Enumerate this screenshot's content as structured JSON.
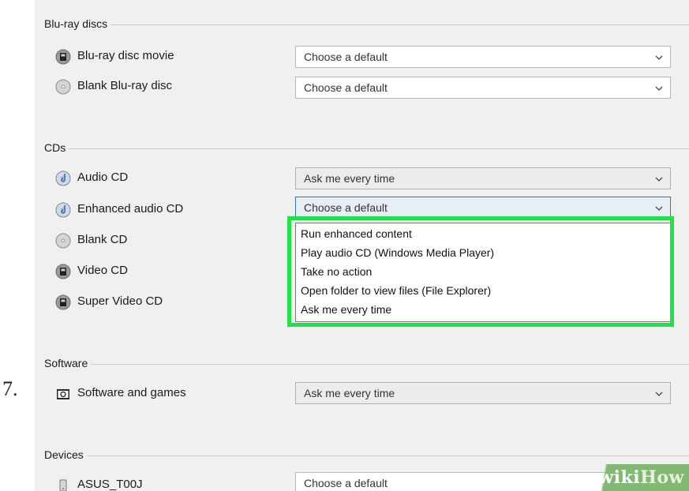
{
  "step_number": "7.",
  "sections": [
    {
      "key": "bluray",
      "title": "Blu-ray discs"
    },
    {
      "key": "cds",
      "title": "CDs"
    },
    {
      "key": "software",
      "title": "Software"
    },
    {
      "key": "devices",
      "title": "Devices"
    }
  ],
  "rows": {
    "bluray_movie": {
      "label": "Blu-ray disc movie",
      "icon": "disc-film-icon",
      "value": "Choose a default"
    },
    "blank_bluray": {
      "label": "Blank Blu-ray disc",
      "icon": "blank-disc-icon",
      "value": "Choose a default"
    },
    "audio_cd": {
      "label": "Audio CD",
      "icon": "audio-disc-icon",
      "value": "Ask me every time"
    },
    "enhanced_audio_cd": {
      "label": "Enhanced audio CD",
      "icon": "audio-disc-icon",
      "value": "Choose a default"
    },
    "blank_cd": {
      "label": "Blank CD",
      "icon": "blank-disc-icon"
    },
    "video_cd": {
      "label": "Video CD",
      "icon": "disc-film-icon"
    },
    "super_video_cd": {
      "label": "Super Video CD",
      "icon": "disc-film-icon"
    },
    "software_games": {
      "label": "Software and games",
      "icon": "software-icon",
      "value": "Ask me every time"
    },
    "asus": {
      "label": "ASUS_T00J",
      "icon": "device-icon",
      "value": "Choose a default"
    }
  },
  "dropdown_options": [
    "Run enhanced content",
    "Play audio CD (Windows Media Player)",
    "Take no action",
    "Open folder to view files (File Explorer)",
    "Ask me every time"
  ],
  "watermark": {
    "part1": "wiki",
    "part2": "How"
  },
  "colors": {
    "highlight": "#22e04a",
    "panel": "#f0f0f0",
    "watermark": "#82b874"
  }
}
